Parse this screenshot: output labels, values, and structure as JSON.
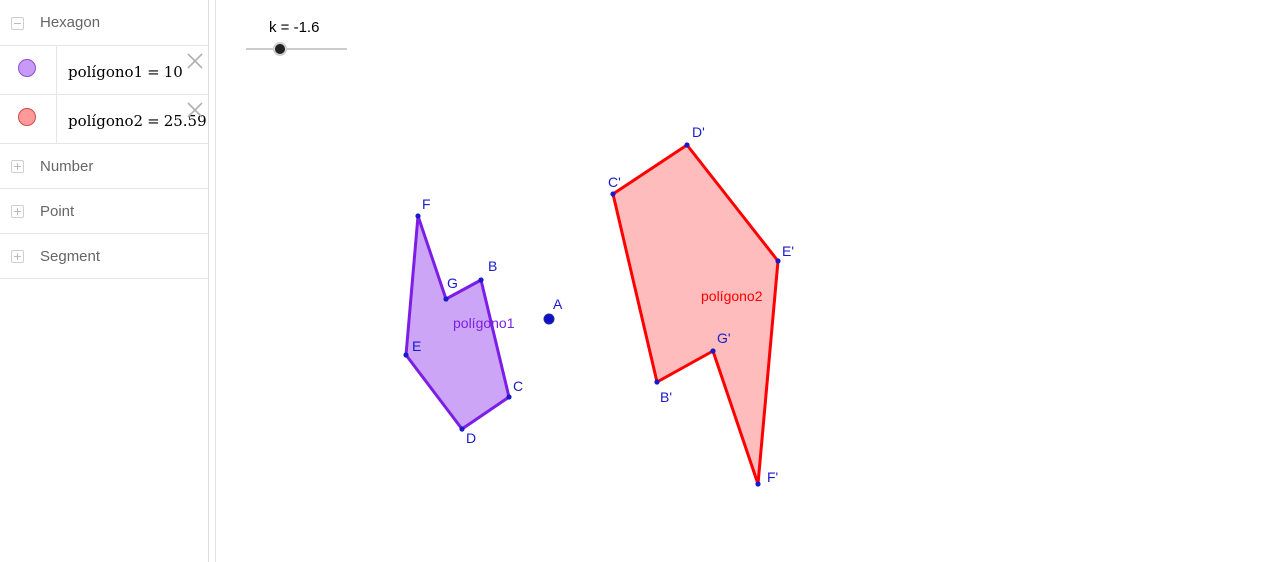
{
  "algebra": {
    "groups": [
      {
        "toggle": "−",
        "label": "Hexagon"
      },
      {
        "toggle": "+",
        "label": "Number"
      },
      {
        "toggle": "+",
        "label": "Point"
      },
      {
        "toggle": "+",
        "label": "Segment"
      }
    ],
    "objects": [
      {
        "name": "polígono1",
        "eq": "=",
        "value": "10",
        "color": "#c79bf5",
        "stroke": "#8a4fd6"
      },
      {
        "name": "polígono2",
        "eq": "=",
        "value": "25.59",
        "color": "#ff9a9a",
        "stroke": "#d14a4a"
      }
    ]
  },
  "slider": {
    "label": "k = -1.6",
    "value": -1.6
  },
  "graphics": {
    "colors": {
      "poly1": "#7c1ee6",
      "poly1_fill": "#c79bf5",
      "poly2": "#ff0000",
      "poly2_fill": "#ffb8b8",
      "point": "#0000cc"
    },
    "poly1_label": "polígono1",
    "poly2_label": "polígono2",
    "points": {
      "A": "A",
      "B": "B",
      "C": "C",
      "D": "D",
      "E": "E",
      "F": "F",
      "G": "G",
      "Bp": "B'",
      "Cp": "C'",
      "Dp": "D'",
      "Ep": "E'",
      "Fp": "F'",
      "Gp": "G'"
    }
  }
}
